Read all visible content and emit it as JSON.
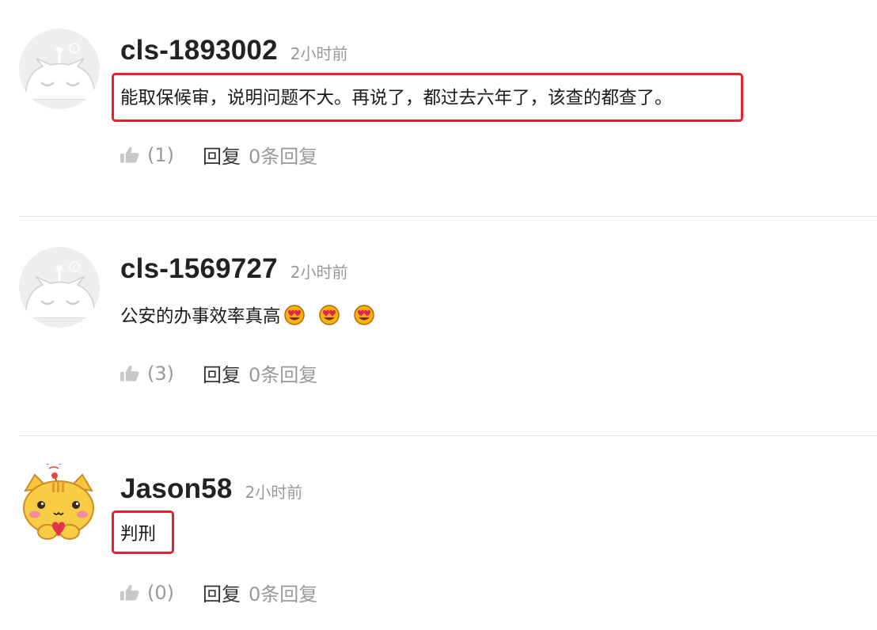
{
  "comments": [
    {
      "username": "cls-1893002",
      "time": "2小时前",
      "text": "能取保候审，说明问题不大。再说了，都过去六年了，该查的都查了。",
      "likes": "(1)",
      "reply_label": "回复",
      "reply_count": "0条回复",
      "avatar": "default-cat-avatar-icon",
      "highlighted": true
    },
    {
      "username": "cls-1569727",
      "time": "2小时前",
      "text": "公安的办事效率真高",
      "emojis": [
        "heart-eyes-emoji-icon",
        "heart-eyes-emoji-icon",
        "heart-eyes-emoji-icon"
      ],
      "likes": "(3)",
      "reply_label": "回复",
      "reply_count": "0条回复",
      "avatar": "default-cat-avatar-icon",
      "highlighted": false
    },
    {
      "username": "Jason58",
      "time": "2小时前",
      "text": "判刑",
      "likes": "(0)",
      "reply_label": "回复",
      "reply_count": "0条回复",
      "avatar": "yellow-cat-avatar-icon",
      "highlighted": true
    }
  ],
  "colors": {
    "highlight_border": "#e8202a",
    "muted_text": "#999999",
    "divider": "#e2e2e2"
  }
}
